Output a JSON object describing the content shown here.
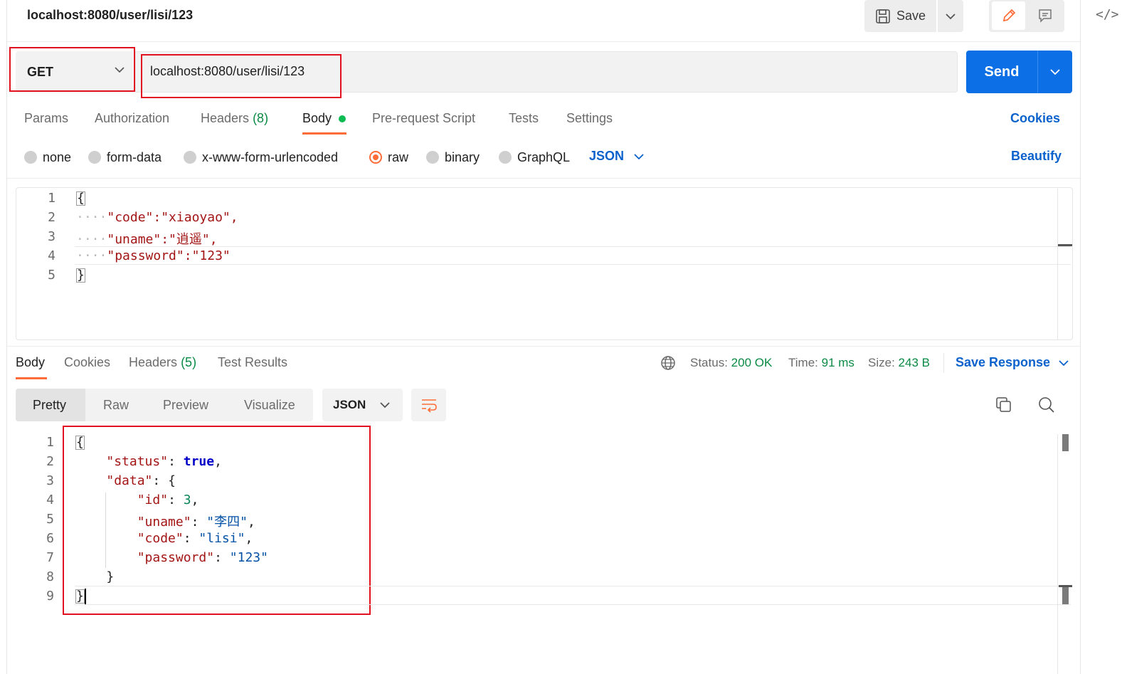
{
  "request": {
    "title": "localhost:8080/user/lisi/123",
    "save_label": "Save",
    "method": "GET",
    "url": "localhost:8080/user/lisi/123",
    "send_label": "Send"
  },
  "request_tabs": {
    "params": "Params",
    "authorization": "Authorization",
    "headers": "Headers",
    "headers_count": "(8)",
    "body": "Body",
    "pre_request": "Pre-request Script",
    "tests": "Tests",
    "settings": "Settings",
    "cookies": "Cookies"
  },
  "body_modes": {
    "none": "none",
    "form_data": "form-data",
    "urlencoded": "x-www-form-urlencoded",
    "raw": "raw",
    "binary": "binary",
    "graphql": "GraphQL",
    "selected": "raw",
    "language": "JSON",
    "beautify": "Beautify"
  },
  "request_body": {
    "line_numbers": [
      "1",
      "2",
      "3",
      "4",
      "5"
    ],
    "lines": [
      "{",
      "\"code\":\"xiaoyao\",",
      "\"uname\":\"逍遥\",",
      "\"password\":\"123\"",
      "}"
    ]
  },
  "response_tabs": {
    "body": "Body",
    "cookies": "Cookies",
    "headers": "Headers",
    "headers_count": "(5)",
    "test_results": "Test Results"
  },
  "response_status": {
    "status_label": "Status:",
    "status_value": "200 OK",
    "time_label": "Time:",
    "time_value": "91 ms",
    "size_label": "Size:",
    "size_value": "243 B",
    "save_response": "Save Response"
  },
  "response_view": {
    "pretty": "Pretty",
    "raw": "Raw",
    "preview": "Preview",
    "visualize": "Visualize",
    "format": "JSON"
  },
  "response_body": {
    "line_numbers": [
      "1",
      "2",
      "3",
      "4",
      "5",
      "6",
      "7",
      "8",
      "9"
    ],
    "status_key": "\"status\"",
    "status_value": "true",
    "data_key": "\"data\"",
    "id_key": "\"id\"",
    "id_value": "3",
    "uname_key": "\"uname\"",
    "uname_value": "\"李四\"",
    "code_key": "\"code\"",
    "code_value": "\"lisi\"",
    "password_key": "\"password\"",
    "password_value": "\"123\""
  },
  "colors": {
    "accent_orange": "#ff6c37",
    "send_blue": "#0d6fe6",
    "link_blue": "#0b62cc",
    "status_green": "#0a8a45",
    "annotation_red": "#e0121f"
  }
}
